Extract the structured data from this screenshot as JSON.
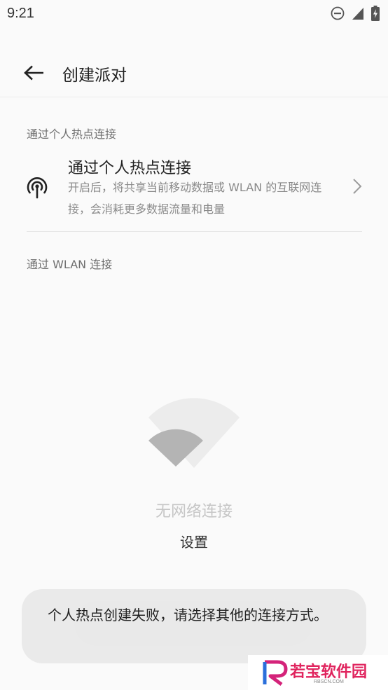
{
  "status_bar": {
    "time": "9:21",
    "icons": [
      "do-not-disturb-icon",
      "cell-signal-icon",
      "battery-charging-icon"
    ]
  },
  "toolbar": {
    "back_icon": "back-arrow-icon",
    "title": "创建派对"
  },
  "sections": {
    "hotspot_header": "通过个人热点连接",
    "wlan_header": "通过 WLAN 连接"
  },
  "hotspot_item": {
    "icon": "hotspot-icon",
    "title": "通过个人热点连接",
    "description": "开启后，将共享当前移动数据或 WLAN 的互联网连接，会消耗更多数据流量和电量",
    "chevron_icon": "chevron-right-icon"
  },
  "empty_state": {
    "icon": "wifi-off-illustration-icon",
    "message": "无网络连接",
    "settings_label": "设置"
  },
  "toast": {
    "message": "个人热点创建失败，请选择其他的连接方式。"
  },
  "watermark": {
    "text": "若宝软件园",
    "sub": "RBSCN.COM"
  },
  "colors": {
    "background": "#fafafa",
    "secondary_text": "#8a8a8a",
    "toast_bg": "#e9e9e9",
    "watermark_accent": "#e0245e"
  }
}
